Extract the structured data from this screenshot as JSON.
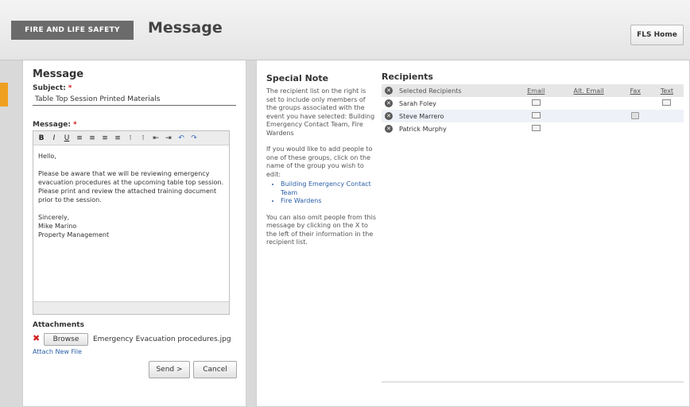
{
  "header": {
    "brand": "FIRE AND LIFE SAFETY",
    "title": "Message",
    "home_button": "FLS Home"
  },
  "compose": {
    "heading": "Message",
    "subject_label": "Subject:",
    "subject_value": "Table Top Session Printed Materials",
    "message_label": "Message:",
    "required_mark": "*",
    "toolbar": [
      "B",
      "I",
      "U",
      "≡",
      "≡",
      "≡",
      "≡",
      "⁝",
      "⁝",
      "⇤",
      "⇥",
      "↶",
      "↷"
    ],
    "body": {
      "greeting": "Hello,",
      "paragraph": "Please be aware that we will be reviewing emergency evacuation procedures at the upcoming table top session. Please print and review the attached training document prior to the session.",
      "signoff": "Sincerely,",
      "name": "Mike Marino",
      "department": "Property Management"
    },
    "attachments_heading": "Attachments",
    "browse_button": "Browse",
    "attachment_filename": "Emergency Evacuation procedures.jpg",
    "attach_new_link": "Attach New File",
    "send_button": "Send >",
    "cancel_button": "Cancel"
  },
  "special_note": {
    "heading": "Special Note",
    "para1": "The recipient list on the right is set to include only members of the groups associated with the event you have selected: Building Emergency Contact Team, Fire Wardens",
    "para2": "If you would like to add people to one of these groups, click on the name of the group you wish to edit:",
    "links": [
      "Building Emergency Contact Team",
      "Fire Wardens"
    ],
    "para3": "You can also omit people from this message by clicking on the X to the left of their information in the recipient list."
  },
  "recipients": {
    "heading": "Recipients",
    "columns": {
      "name": "Selected Recipients",
      "email": "Email",
      "alt_email": "Alt. Email",
      "fax": "Fax",
      "text": "Text"
    },
    "rows": [
      {
        "name": "Sarah Foley",
        "email": true,
        "alt_email": false,
        "fax": false,
        "text": true
      },
      {
        "name": "Steve Marrero",
        "email": true,
        "alt_email": false,
        "fax": true,
        "text": false
      },
      {
        "name": "Patrick Murphy",
        "email": true,
        "alt_email": false,
        "fax": false,
        "text": false
      }
    ]
  }
}
